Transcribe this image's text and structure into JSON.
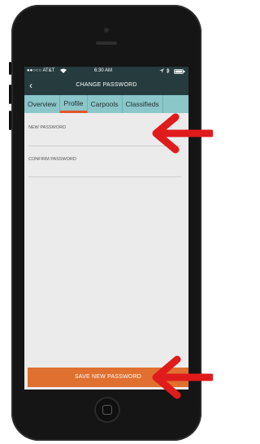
{
  "status_bar": {
    "carrier": "●●○○○ AT&T",
    "time": "6:30 AM"
  },
  "nav": {
    "back_label": "‹",
    "title": "CHANGE PASSWORD"
  },
  "tabs": [
    {
      "label": "Overview",
      "active": false
    },
    {
      "label": "Profile",
      "active": true
    },
    {
      "label": "Carpools",
      "active": false
    },
    {
      "label": "Classifieds",
      "active": false
    }
  ],
  "form": {
    "new_password_label": "NEW PASSWORD",
    "confirm_password_label": "CONFIRM PASSWORD"
  },
  "save_button": {
    "label": "SAVE NEW PASSWORD"
  },
  "colors": {
    "navbar": "#253b3d",
    "tabs": "#8bc6c9",
    "accent": "#e0562b",
    "button": "#e0702f",
    "annotation_arrow": "#e01b1b"
  }
}
